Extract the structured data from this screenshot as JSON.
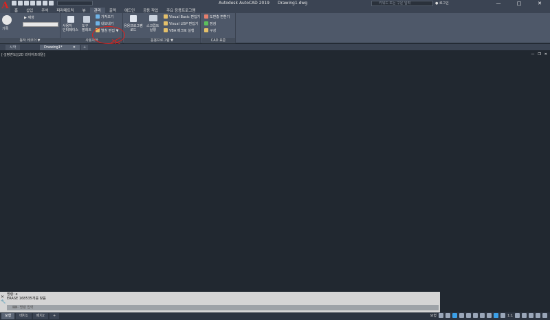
{
  "app": {
    "logo": "A",
    "title": "Autodesk AutoCAD 2019",
    "file": "Drawing1.dwg"
  },
  "search": {
    "placeholder": "키워드 또는 구문 입력"
  },
  "user": {
    "label": "로그인"
  },
  "menu": [
    "홈",
    "삽입",
    "주석",
    "파라메트릭",
    "뷰",
    "관리",
    "출력",
    "애드인",
    "공동 작업",
    "주요 응용프로그램"
  ],
  "ribbon": {
    "action": {
      "record": "기록",
      "play": "재생",
      "footer": "동작 레코더 ▼"
    },
    "customize": {
      "ui": "사용자\n인터페이스",
      "tool": "도구\n팔레트",
      "import": "가져오기",
      "export": "내보내기",
      "alias": "별칭 편집 ▼",
      "footer": "사용자화"
    },
    "apps": {
      "load": "응용프로그램\n로드",
      "script": "스크립트\n실행",
      "vba": "Visual Basic 편집기",
      "vlisp": "Visual LISP 편집기",
      "macro": "VBA 매크로 실행",
      "footer": "응용프로그램 ▼"
    },
    "cad": {
      "convert": "도면층 변환기",
      "check": "점검",
      "config": "구성",
      "footer": "CAD 표준"
    }
  },
  "tabs": [
    "시작",
    "Drawing1*",
    "+"
  ],
  "viewport": {
    "label": "[-][평면도][2D 와이어프레임]"
  },
  "command": {
    "history1": "명령: e",
    "history2": "ERASE 168535개를 찾음",
    "placeholder": "명령 입력"
  },
  "layout_tabs": [
    "모형",
    "배치1",
    "배치2",
    "+"
  ],
  "status": {
    "model": "모형",
    "scale": "1:1"
  },
  "colors": {
    "accent": "#3ba0e8",
    "annotation": "#e0201b",
    "logo": "#e0221f"
  }
}
